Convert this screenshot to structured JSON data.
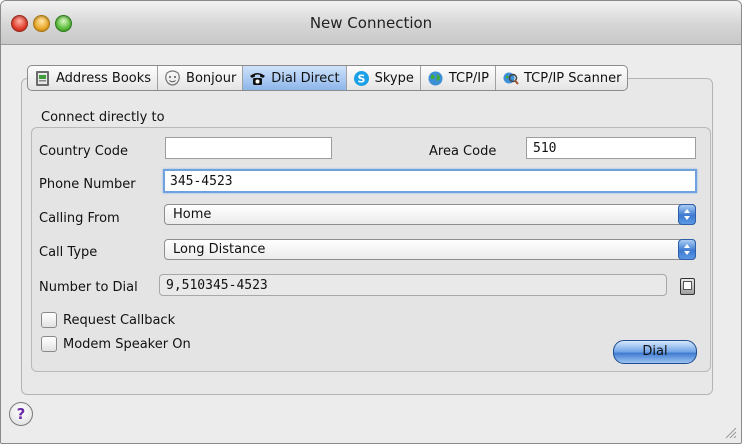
{
  "window": {
    "title": "New Connection"
  },
  "tabs": [
    {
      "label": "Address Books",
      "icon": "address-book-icon",
      "active": false
    },
    {
      "label": "Bonjour",
      "icon": "bonjour-icon",
      "active": false
    },
    {
      "label": "Dial Direct",
      "icon": "telephone-icon",
      "active": true
    },
    {
      "label": "Skype",
      "icon": "skype-icon",
      "active": false
    },
    {
      "label": "TCP/IP",
      "icon": "globe-icon",
      "active": false
    },
    {
      "label": "TCP/IP Scanner",
      "icon": "scanner-icon",
      "active": false
    }
  ],
  "form": {
    "section_label": "Connect directly to",
    "country_code": {
      "label": "Country Code",
      "value": ""
    },
    "area_code": {
      "label": "Area Code",
      "value": "510"
    },
    "phone_number": {
      "label": "Phone Number",
      "value": "345-4523"
    },
    "calling_from": {
      "label": "Calling From",
      "selected": "Home"
    },
    "call_type": {
      "label": "Call Type",
      "selected": "Long Distance"
    },
    "number_to_dial": {
      "label": "Number to Dial",
      "value": "9,510345-4523"
    },
    "request_callback": {
      "label": "Request Callback",
      "checked": false
    },
    "modem_speaker": {
      "label": "Modem Speaker On",
      "checked": false
    },
    "dial_button": "Dial"
  },
  "help": {
    "label": "?"
  },
  "colors": {
    "accent": "#6fa3e6",
    "active_tab": "#8db6ea"
  }
}
